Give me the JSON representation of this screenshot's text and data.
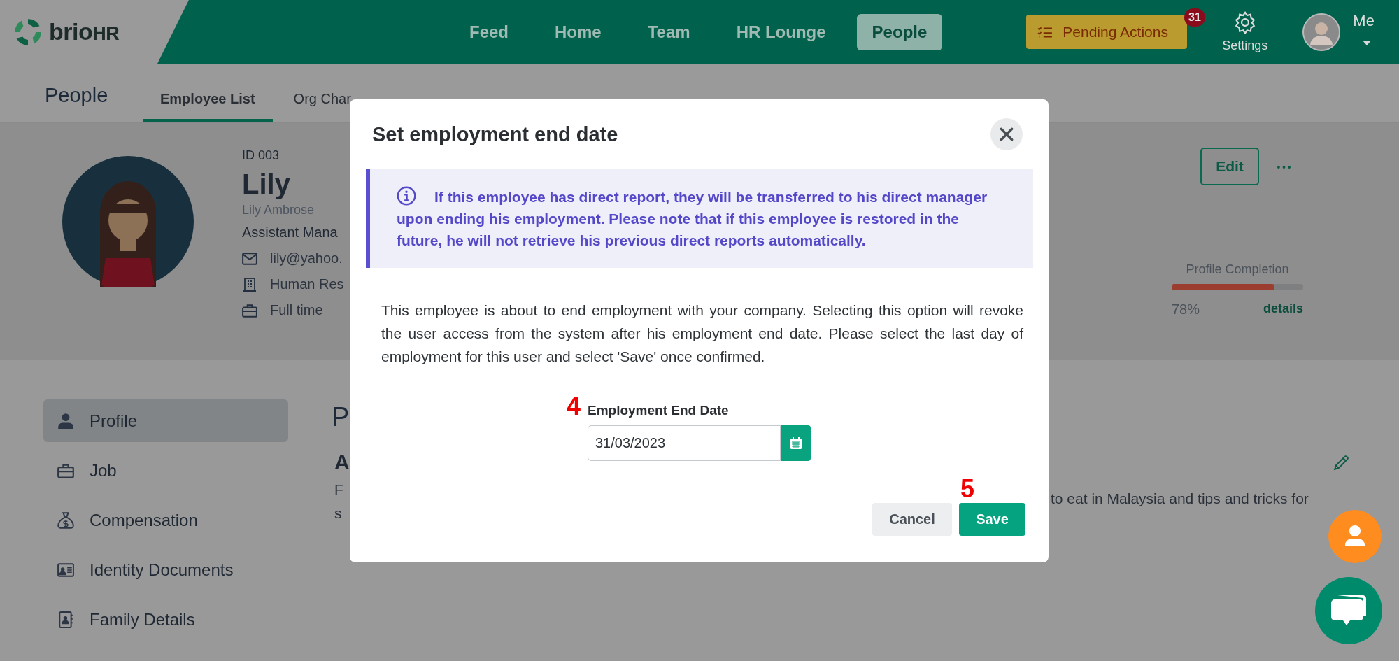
{
  "header": {
    "logo": {
      "text": "brio",
      "suffix": "HR"
    },
    "nav": [
      {
        "label": "Feed",
        "selected": false
      },
      {
        "label": "Home",
        "selected": false
      },
      {
        "label": "Team",
        "selected": false
      },
      {
        "label": "HR Lounge",
        "selected": false
      },
      {
        "label": "People",
        "selected": true
      }
    ],
    "pending_actions": {
      "label": "Pending Actions",
      "badge": "31"
    },
    "settings": {
      "label": "Settings"
    },
    "account": {
      "label": "Me"
    }
  },
  "subheader": {
    "title": "People",
    "tabs": [
      {
        "label": "Employee List",
        "selected": true
      },
      {
        "label": "Org Char",
        "selected": false
      }
    ]
  },
  "profile": {
    "id": "ID 003",
    "name": "Lily",
    "full_name": "Lily Ambrose",
    "position": "Assistant Mana",
    "details": [
      "lily@yahoo.",
      "Human Res",
      "Full time"
    ],
    "edit": "Edit",
    "completion": {
      "label": "Profile Completion",
      "level": 0.78,
      "reading": "78%",
      "link": "details"
    }
  },
  "sidebar": {
    "items": [
      {
        "label": "Profile",
        "selected": true
      },
      {
        "label": "Job",
        "selected": false
      },
      {
        "label": "Compensation",
        "selected": false
      },
      {
        "label": "Identity Documents",
        "selected": false
      },
      {
        "label": "Family Details",
        "selected": false
      }
    ]
  },
  "content": {
    "section_title": "P",
    "about_title": "A",
    "about_lines": [
      "F",
      "s"
    ],
    "about_right": "to eat in Malaysia and tips and tricks for"
  },
  "dialog": {
    "title": "Set employment end date",
    "notice": "If this employee has direct report, they will be transferred to his direct manager upon ending his employment. Please note that if this employee is restored in the future, he will not retrieve his previous direct reports automatically.",
    "body": "This employee is about to end employment with your company. Selecting this option will revoke the user access from the system after his employment end date. Please select the last day of employment for this user and select 'Save' once confirmed.",
    "field": {
      "marker": "4",
      "label": "Employment End Date",
      "value": "31/03/2023"
    },
    "buttons": [
      {
        "kind": "secondary",
        "label": "Cancel"
      },
      {
        "kind": "primary",
        "label": "Save",
        "marker": "5"
      }
    ]
  }
}
